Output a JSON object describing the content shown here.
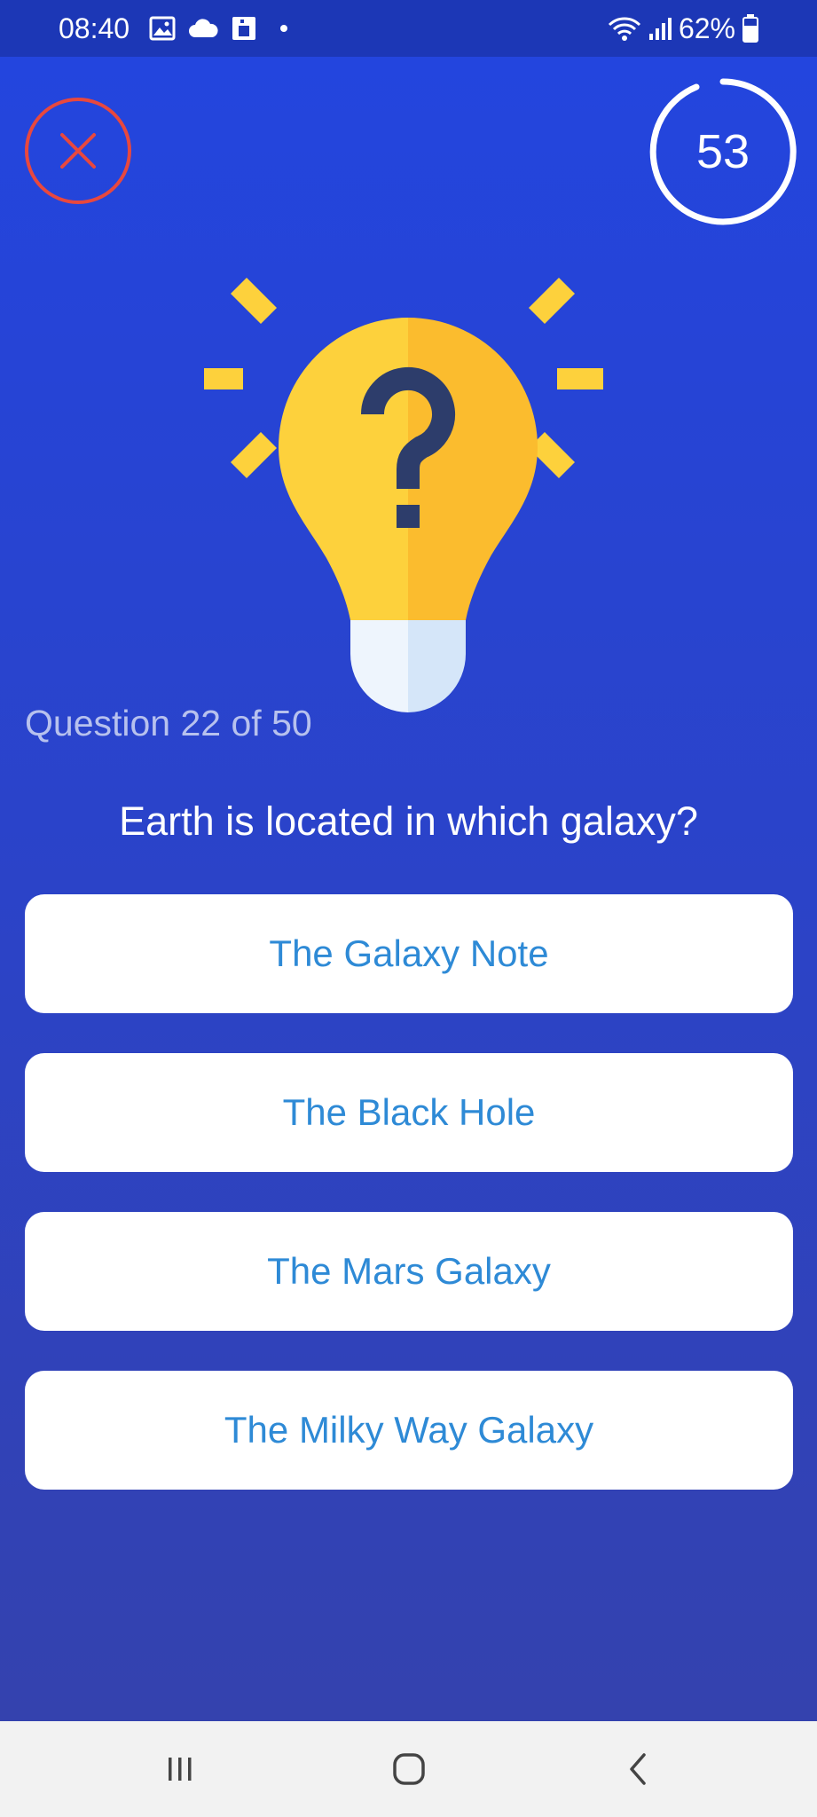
{
  "status_bar": {
    "time": "08:40",
    "battery": "62%",
    "icons": [
      "gallery-icon",
      "cloud-icon",
      "sim-icon",
      "wifi-icon",
      "signal-icon",
      "battery-icon"
    ]
  },
  "quiz": {
    "timer": "53",
    "question_counter": "Question 22 of 50",
    "question": "Earth is located in which galaxy?",
    "answers": [
      "The Galaxy Note",
      "The Black Hole",
      "The Mars Galaxy",
      "The Milky Way Galaxy"
    ]
  },
  "colors": {
    "background_top": "#2345de",
    "background_bottom": "#3442ae",
    "close_red": "#e8483e",
    "answer_text": "#2e8ad6",
    "bulb_yellow": "#fdd13c",
    "bulb_shade": "#fbbc2e",
    "question_mark": "#2d3d6b"
  },
  "nav_bar": {
    "icons": [
      "recent-apps-icon",
      "home-icon",
      "back-icon"
    ]
  }
}
